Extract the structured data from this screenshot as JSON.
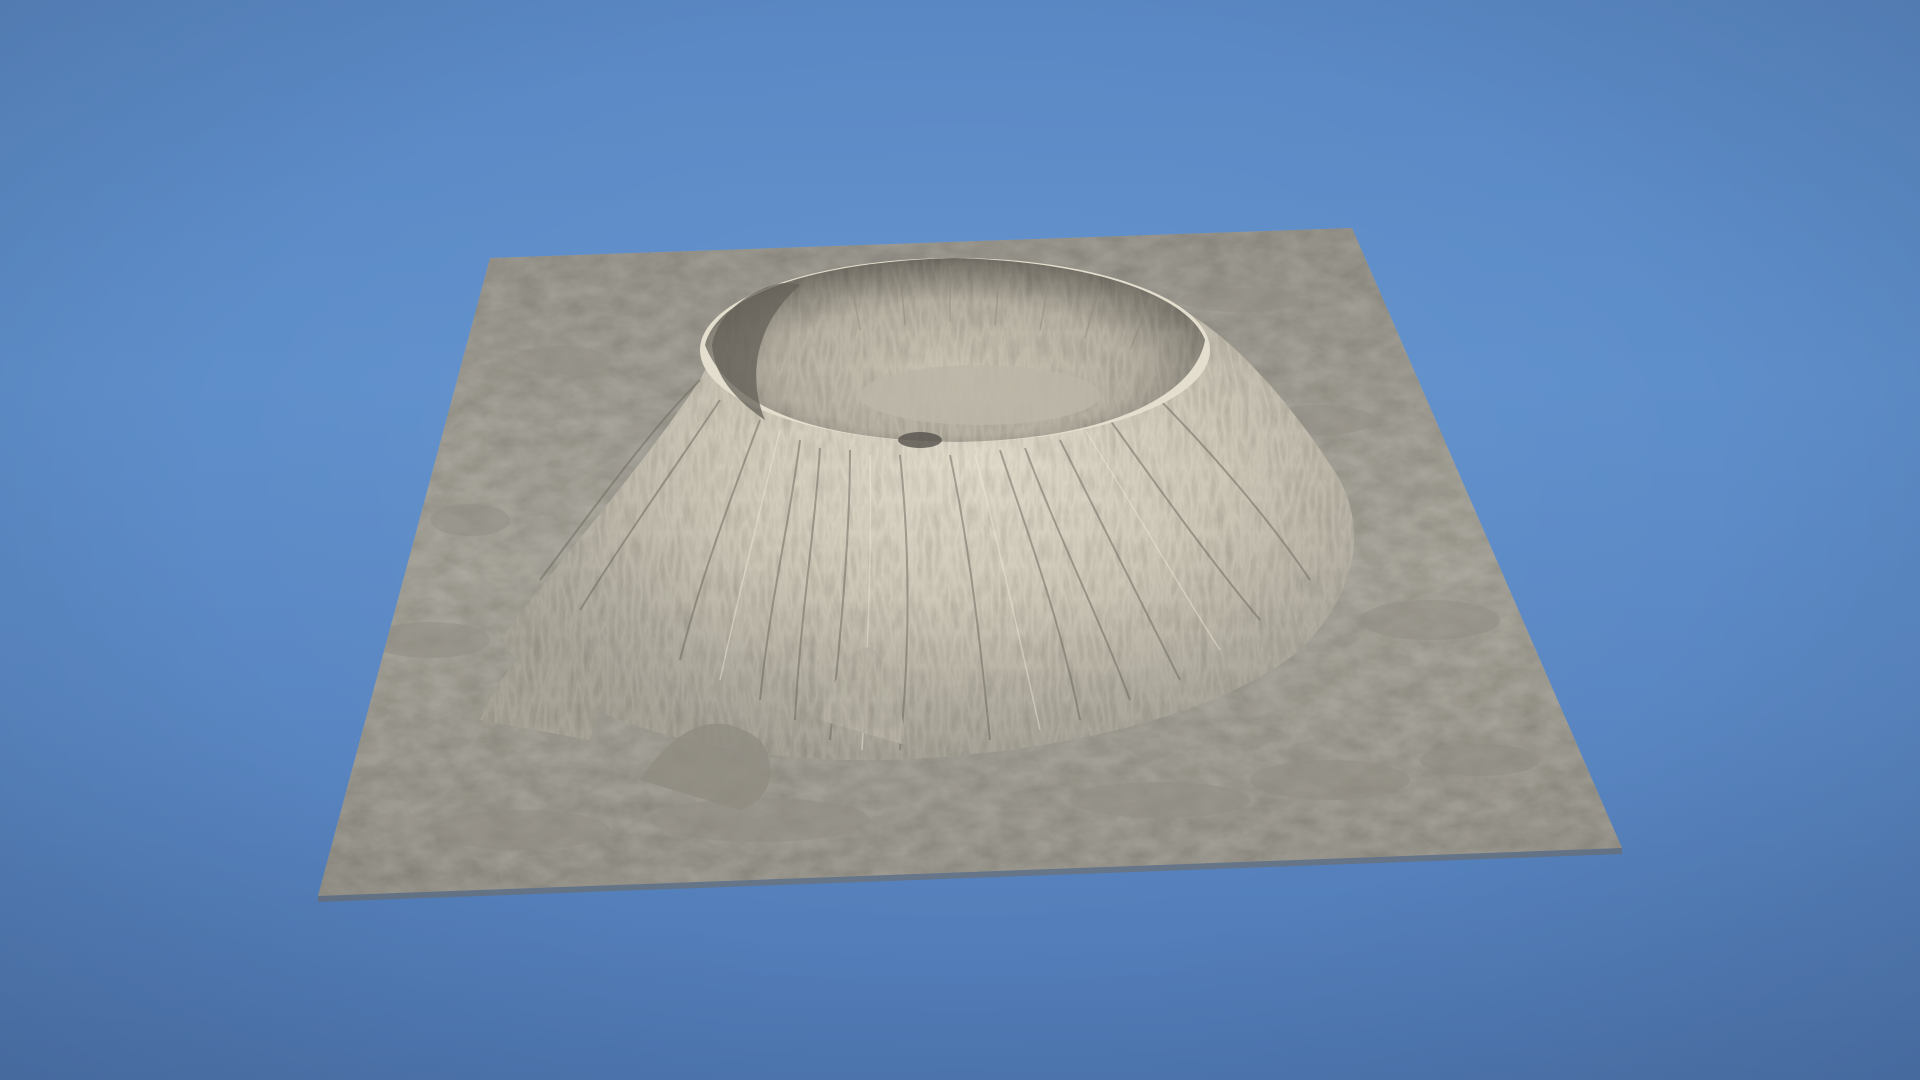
{
  "scene": {
    "subject": "volcano-crater-terrain-mesh",
    "background_color": "#5d8bc7",
    "terrain_color": "#a9a69c",
    "terrain_highlight": "#d9d3c3",
    "terrain_shadow": "#5f5c55"
  }
}
